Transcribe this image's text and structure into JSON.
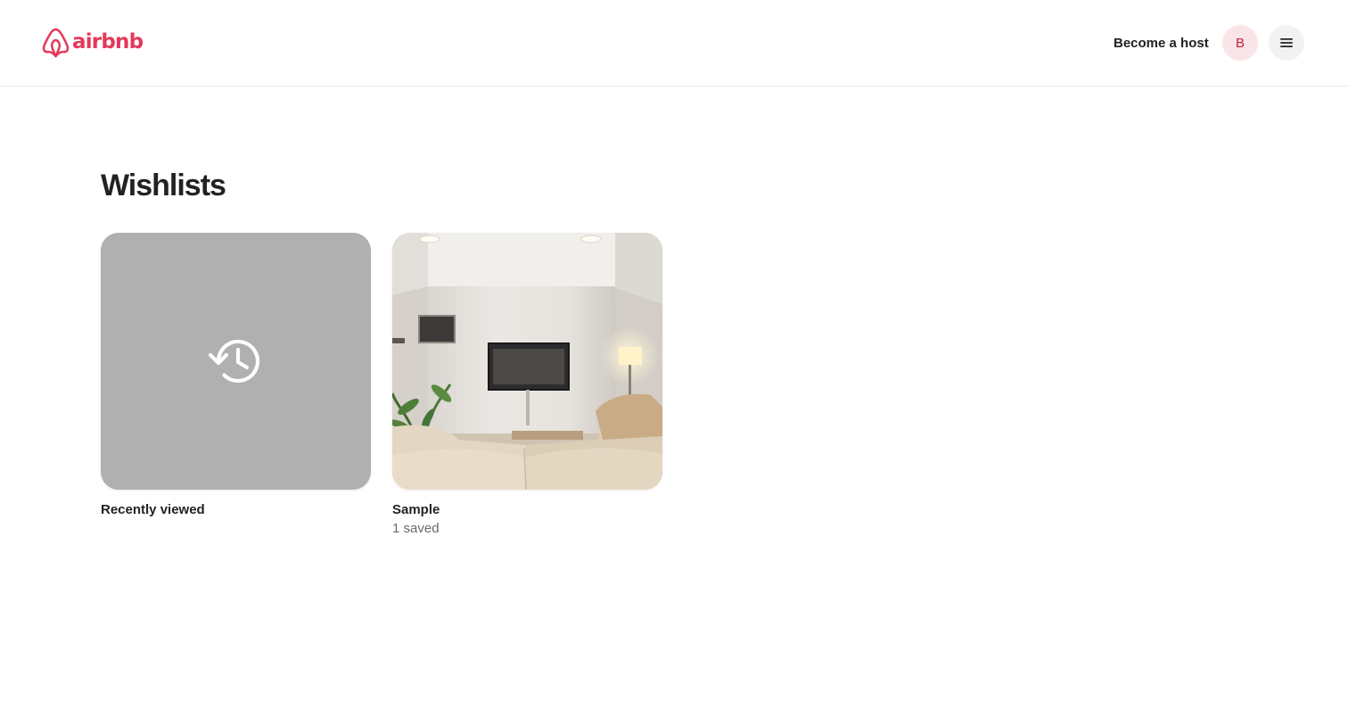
{
  "colors": {
    "brand": "#e3395b",
    "text": "#222222",
    "muted": "#6a6a6a",
    "placeholder_tile": "#b0b0b0",
    "avatar_bg": "#fbe4e7",
    "avatar_text": "#c0213f",
    "menu_bg": "#f2f2f2"
  },
  "header": {
    "logo_text": "airbnb",
    "logo_icon": "airbnb-belo-icon",
    "become_host_label": "Become a host",
    "avatar_initial": "B",
    "menu_icon": "hamburger-menu-icon"
  },
  "main": {
    "title": "Wishlists",
    "wishlists": [
      {
        "name": "Recently viewed",
        "subtitle": "",
        "icon": "history-icon"
      },
      {
        "name": "Sample",
        "subtitle": "1 saved",
        "image": "living-room-photo"
      }
    ]
  }
}
